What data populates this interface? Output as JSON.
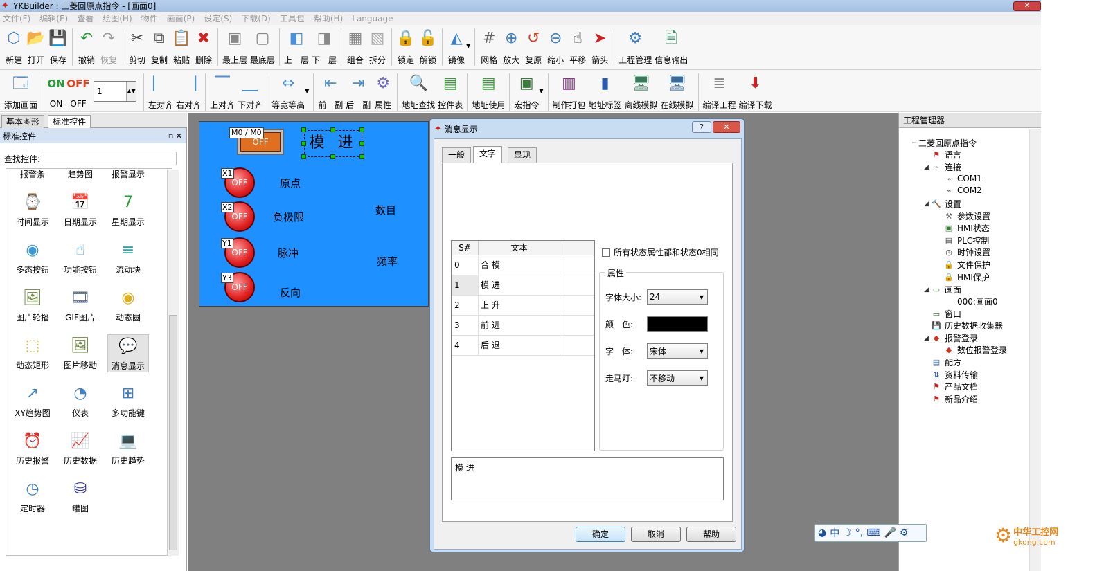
{
  "window": {
    "title": "YKBuilder : 三菱回原点指令 - [画面0]"
  },
  "menu": [
    "文件(F)",
    "编辑(E)",
    "查看",
    "绘图(H)",
    "物件",
    "画面(P)",
    "设定(S)",
    "下载(D)",
    "工具包",
    "帮助(H)",
    "Language"
  ],
  "toolbar1": [
    {
      "label": "新建",
      "icon": "new-icon",
      "glyph": "⬡",
      "color": "#3a7fc8"
    },
    {
      "label": "打开",
      "icon": "open-folder-icon",
      "glyph": "📂",
      "color": "#3a7fc8"
    },
    {
      "label": "保存",
      "icon": "save-icon",
      "glyph": "💾",
      "color": "#3a7fc8"
    },
    {
      "sep": true
    },
    {
      "label": "撤销",
      "icon": "undo-icon",
      "glyph": "↶",
      "color": "#2a9a3a"
    },
    {
      "label": "恢复",
      "icon": "redo-icon",
      "glyph": "↷",
      "color": "#9a9a9a",
      "disabled": true
    },
    {
      "sep": true
    },
    {
      "label": "剪切",
      "icon": "cut-icon",
      "glyph": "✂",
      "color": "#444"
    },
    {
      "label": "复制",
      "icon": "copy-icon",
      "glyph": "⧉",
      "color": "#666"
    },
    {
      "label": "粘贴",
      "icon": "paste-icon",
      "glyph": "📋",
      "color": "#2a9a3a"
    },
    {
      "label": "删除",
      "icon": "delete-icon",
      "glyph": "✖",
      "color": "#d02020"
    },
    {
      "sep": true
    },
    {
      "label": "最上层",
      "icon": "bring-to-front-icon",
      "glyph": "▣",
      "color": "#888"
    },
    {
      "label": "最底层",
      "icon": "send-to-back-icon",
      "glyph": "▢",
      "color": "#888"
    },
    {
      "sep": true
    },
    {
      "label": "上一层",
      "icon": "bring-forward-icon",
      "glyph": "◧",
      "color": "#4a90d8"
    },
    {
      "label": "下一层",
      "icon": "send-backward-icon",
      "glyph": "◨",
      "color": "#888"
    },
    {
      "sep": true
    },
    {
      "label": "组合",
      "icon": "group-icon",
      "glyph": "▦",
      "color": "#888"
    },
    {
      "label": "拆分",
      "icon": "ungroup-icon",
      "glyph": "▧",
      "color": "#aaa"
    },
    {
      "sep": true
    },
    {
      "label": "锁定",
      "icon": "lock-icon",
      "glyph": "🔒",
      "color": "#e0a020"
    },
    {
      "label": "解锁",
      "icon": "unlock-icon",
      "glyph": "🔓",
      "color": "#e0a020"
    },
    {
      "sep": true
    },
    {
      "label": "镜像",
      "icon": "mirror-icon",
      "glyph": "◭",
      "color": "#3a7fc8",
      "dropdown": true
    },
    {
      "sep": true
    },
    {
      "label": "网格",
      "icon": "grid-icon",
      "glyph": "#",
      "color": "#666"
    },
    {
      "label": "放大",
      "icon": "zoom-in-icon",
      "glyph": "⊕",
      "color": "#3a7fc8"
    },
    {
      "label": "复原",
      "icon": "restore-icon",
      "glyph": "↺",
      "color": "#d04020"
    },
    {
      "label": "缩小",
      "icon": "zoom-out-icon",
      "glyph": "⊖",
      "color": "#3a7fc8"
    },
    {
      "label": "平移",
      "icon": "pan-hand-icon",
      "glyph": "☝",
      "color": "#444"
    },
    {
      "label": "箭头",
      "icon": "arrow-pointer-icon",
      "glyph": "➤",
      "color": "#d02020"
    },
    {
      "sep": true
    },
    {
      "label": "工程管理",
      "icon": "project-manager-icon",
      "glyph": "⚙",
      "color": "#3a7fc8"
    },
    {
      "label": "信息输出",
      "icon": "info-output-icon",
      "glyph": "🗎",
      "color": "#3a9a6a"
    }
  ],
  "toolbar2": [
    {
      "label": "添加画面",
      "icon": "add-screen-icon",
      "glyph": "🗔",
      "color": "#3a7fc8"
    },
    {
      "sep": true
    },
    {
      "label": "ON",
      "icon": "on-icon",
      "glyph": "ON",
      "color": "#2a9a3a",
      "text": true
    },
    {
      "label": "OFF",
      "icon": "off-icon",
      "glyph": "OFF",
      "color": "#e04020",
      "text": true
    },
    {
      "spin": true
    },
    {
      "sep": true
    },
    {
      "label": "左对齐",
      "icon": "align-left-icon",
      "glyph": "⎸",
      "color": "#4a90d8"
    },
    {
      "label": "右对齐",
      "icon": "align-right-icon",
      "glyph": "⎹",
      "color": "#4a90d8"
    },
    {
      "sep": true
    },
    {
      "label": "上对齐",
      "icon": "align-top-icon",
      "glyph": "⎺",
      "color": "#4a90d8"
    },
    {
      "label": "下对齐",
      "icon": "align-bottom-icon",
      "glyph": "⎽",
      "color": "#4a90d8"
    },
    {
      "sep": true
    },
    {
      "label": "等宽等高",
      "icon": "same-size-icon",
      "glyph": "⇔",
      "color": "#4a90d8",
      "dropdown": true
    },
    {
      "sep": true
    },
    {
      "label": "前一副",
      "icon": "previous-screen-icon",
      "glyph": "⇤",
      "color": "#4a90d8"
    },
    {
      "label": "后一副",
      "icon": "next-screen-icon",
      "glyph": "⇥",
      "color": "#4a90d8"
    },
    {
      "label": "属性",
      "icon": "properties-icon",
      "glyph": "⚙",
      "color": "#6a6ac8"
    },
    {
      "sep": true
    },
    {
      "label": "地址查找",
      "icon": "address-search-icon",
      "glyph": "🔍",
      "color": "#2a8a6a"
    },
    {
      "label": "控件表",
      "icon": "control-table-icon",
      "glyph": "▤",
      "color": "#3a9a3a"
    },
    {
      "sep": true
    },
    {
      "label": "地址使用",
      "icon": "address-use-icon",
      "glyph": "▤",
      "color": "#3a9a3a"
    },
    {
      "sep": true
    },
    {
      "label": "宏指令",
      "icon": "macro-icon",
      "glyph": "▣",
      "color": "#3a7a3a",
      "dropdown": true
    },
    {
      "sep": true
    },
    {
      "label": "制作打包",
      "icon": "package-icon",
      "glyph": "▥",
      "color": "#8a3a8a"
    },
    {
      "label": "地址标签",
      "icon": "address-tag-icon",
      "glyph": "▮",
      "color": "#2a5ab0"
    },
    {
      "label": "离线模拟",
      "icon": "offline-sim-icon",
      "glyph": "🖥",
      "color": "#3a7a5a"
    },
    {
      "label": "在线模拟",
      "icon": "online-sim-icon",
      "glyph": "🖥",
      "color": "#3a6a9a"
    },
    {
      "sep": true
    },
    {
      "label": "编译工程",
      "icon": "compile-icon",
      "glyph": "≣",
      "color": "#888"
    },
    {
      "label": "编译下载",
      "icon": "compile-download-icon",
      "glyph": "⬇",
      "color": "#d02020"
    }
  ],
  "spin_value": "1",
  "left_tabs": [
    "基本图形",
    "标准控件"
  ],
  "left_panel": {
    "title": "标准控件",
    "search_label": "查找控件:",
    "search_value": "",
    "items": [
      {
        "label": "报警条",
        "icon": "alarm-bar-icon",
        "glyph": "",
        "color": "#444"
      },
      {
        "label": "趋势图",
        "icon": "trend-chart-icon",
        "glyph": "",
        "color": "#444"
      },
      {
        "label": "报警显示",
        "icon": "alarm-display-icon",
        "glyph": "",
        "color": "#444"
      },
      {
        "label": "时间显示",
        "icon": "time-display-icon",
        "glyph": "⌚",
        "color": "#3a7fc8"
      },
      {
        "label": "日期显示",
        "icon": "date-display-icon",
        "glyph": "📅",
        "color": "#e07020"
      },
      {
        "label": "星期显示",
        "icon": "week-display-icon",
        "glyph": "7",
        "color": "#2a9a3a"
      },
      {
        "label": "多态按钮",
        "icon": "multistate-button-icon",
        "glyph": "◉",
        "color": "#3a9ad8"
      },
      {
        "label": "功能按钮",
        "icon": "function-button-icon",
        "glyph": "☝",
        "color": "#3a9ad8"
      },
      {
        "label": "流动块",
        "icon": "flow-block-icon",
        "glyph": "≡",
        "color": "#2aa8a8"
      },
      {
        "label": "图片轮播",
        "icon": "picture-carousel-icon",
        "glyph": "🖼",
        "color": "#6a8a3a"
      },
      {
        "label": "GIF图片",
        "icon": "gif-picture-icon",
        "glyph": "🎞",
        "color": "#5a6a8a"
      },
      {
        "label": "动态圆",
        "icon": "dynamic-circle-icon",
        "glyph": "◉",
        "color": "#e0b020"
      },
      {
        "label": "动态矩形",
        "icon": "dynamic-rect-icon",
        "glyph": "⬚",
        "color": "#e0b020"
      },
      {
        "label": "图片移动",
        "icon": "picture-move-icon",
        "glyph": "🖼",
        "color": "#6a8a3a"
      },
      {
        "label": "消息显示",
        "icon": "message-display-icon",
        "glyph": "💬",
        "color": "#3a7fc8",
        "selected": true
      },
      {
        "label": "XY趋势图",
        "icon": "xy-trend-icon",
        "glyph": "↗",
        "color": "#3a7fc8"
      },
      {
        "label": "仪表",
        "icon": "meter-icon",
        "glyph": "◔",
        "color": "#3a7fc8"
      },
      {
        "label": "多功能键",
        "icon": "multifunction-key-icon",
        "glyph": "⊞",
        "color": "#3a7fc8"
      },
      {
        "label": "历史报警",
        "icon": "history-alarm-icon",
        "glyph": "⏰",
        "color": "#d02020"
      },
      {
        "label": "历史数据",
        "icon": "history-data-icon",
        "glyph": "📈",
        "color": "#d02020"
      },
      {
        "label": "历史趋势",
        "icon": "history-trend-icon",
        "glyph": "💻",
        "color": "#3a9a6a"
      },
      {
        "label": "定时器",
        "icon": "timer-icon",
        "glyph": "◷",
        "color": "#3a7fc8"
      },
      {
        "label": "罐图",
        "icon": "tank-icon",
        "glyph": "⛁",
        "color": "#2a2ab0"
      }
    ]
  },
  "hmi": {
    "switch": {
      "tag": "M0 / M0",
      "text": "OFF"
    },
    "message": "模 进",
    "lamps": [
      {
        "tag": "X1",
        "text": "OFF",
        "label": "原点"
      },
      {
        "tag": "X2",
        "text": "OFF",
        "label": "负极限"
      },
      {
        "tag": "Y1",
        "text": "OFF",
        "label": "脉冲"
      },
      {
        "tag": "Y3",
        "text": "OFF",
        "label": "反向"
      }
    ],
    "label_count": "数目",
    "label_freq": "频率"
  },
  "dialog": {
    "title": "消息显示",
    "help_btn": "?",
    "close_btn": "✕",
    "tabs": [
      "一般",
      "文字",
      "显现"
    ],
    "table_header": [
      "S#",
      "文本"
    ],
    "rows": [
      {
        "s": "0",
        "t": "合 模"
      },
      {
        "s": "1",
        "t": "模 进"
      },
      {
        "s": "2",
        "t": "上 升"
      },
      {
        "s": "3",
        "t": "前 进"
      },
      {
        "s": "4",
        "t": "后 退"
      }
    ],
    "same_state_label": "所有状态属性都和状态0相同",
    "props_title": "属性",
    "font_size_label": "字体大小:",
    "font_size_value": "24",
    "color_label": "颜　色:",
    "color_value": "#000000",
    "font_label": "字　体:",
    "font_value": "宋体",
    "marquee_label": "走马灯:",
    "marquee_value": "不移动",
    "text_value": "模 进",
    "ok": "确定",
    "cancel": "取消",
    "help": "帮助"
  },
  "right_panel": {
    "title": "工程管理器",
    "tree": [
      {
        "label": "三菱回原点指令",
        "level": 0,
        "toggle": "−",
        "icon": "project-icon",
        "glyph": ""
      },
      {
        "label": "语言",
        "level": 1,
        "toggle": "",
        "icon": "flag-icon",
        "glyph": "⚑",
        "color": "#d02020"
      },
      {
        "label": "连接",
        "level": 1,
        "toggle": "◢",
        "icon": "connect-icon",
        "glyph": "⌁",
        "color": "#666"
      },
      {
        "label": "COM1",
        "level": 2,
        "toggle": "",
        "icon": "com-port-icon",
        "glyph": "⌁",
        "color": "#666"
      },
      {
        "label": "COM2",
        "level": 2,
        "toggle": "",
        "icon": "com-port-icon",
        "glyph": "⌁",
        "color": "#666"
      },
      {
        "label": "设置",
        "level": 1,
        "toggle": "◢",
        "icon": "settings-hammer-icon",
        "glyph": "🔨",
        "color": "#666"
      },
      {
        "label": "参数设置",
        "level": 2,
        "toggle": "",
        "icon": "param-icon",
        "glyph": "⚒",
        "color": "#666"
      },
      {
        "label": "HMI状态",
        "level": 2,
        "toggle": "",
        "icon": "hmi-status-icon",
        "glyph": "▣",
        "color": "#3a7a3a"
      },
      {
        "label": "PLC控制",
        "level": 2,
        "toggle": "",
        "icon": "plc-control-icon",
        "glyph": "▤",
        "color": "#444"
      },
      {
        "label": "时钟设置",
        "level": 2,
        "toggle": "",
        "icon": "clock-icon",
        "glyph": "◷",
        "color": "#444"
      },
      {
        "label": "文件保护",
        "level": 2,
        "toggle": "",
        "icon": "file-lock-icon",
        "glyph": "🔒",
        "color": "#e0a020"
      },
      {
        "label": "HMI保护",
        "level": 2,
        "toggle": "",
        "icon": "hmi-lock-icon",
        "glyph": "🔒",
        "color": "#e0a020"
      },
      {
        "label": "画面",
        "level": 1,
        "toggle": "◢",
        "icon": "screen-icon",
        "glyph": "▭",
        "color": "#2a5a2a"
      },
      {
        "label": "000:画面0",
        "level": 2,
        "toggle": "",
        "icon": "",
        "glyph": "",
        "color": "#000"
      },
      {
        "label": "窗口",
        "level": 1,
        "toggle": "",
        "icon": "window-icon",
        "glyph": "▭",
        "color": "#2a5a2a"
      },
      {
        "label": "历史数据收集器",
        "level": 1,
        "toggle": "",
        "icon": "history-collector-icon",
        "glyph": "💾",
        "color": "#2a4ab0"
      },
      {
        "label": "报警登录",
        "level": 1,
        "toggle": "◢",
        "icon": "alarm-login-icon",
        "glyph": "◆",
        "color": "#d03020"
      },
      {
        "label": "数位报警登录",
        "level": 2,
        "toggle": "",
        "icon": "bit-alarm-icon",
        "glyph": "◆",
        "color": "#d03020"
      },
      {
        "label": "配方",
        "level": 1,
        "toggle": "",
        "icon": "recipe-icon",
        "glyph": "▤",
        "color": "#3a6a9a"
      },
      {
        "label": "资料传输",
        "level": 1,
        "toggle": "",
        "icon": "data-transfer-icon",
        "glyph": "⇅",
        "color": "#2a5ab0"
      },
      {
        "label": "产品文档",
        "level": 1,
        "toggle": "",
        "icon": "flag-icon",
        "glyph": "⚑",
        "color": "#d02020"
      },
      {
        "label": "新品介绍",
        "level": 1,
        "toggle": "",
        "icon": "flag-icon",
        "glyph": "⚑",
        "color": "#d02020"
      }
    ]
  },
  "ime": [
    "中",
    "☽",
    "°,",
    "⌨",
    "🎤",
    "⚙"
  ],
  "watermark": {
    "line1": "中华工控网",
    "line2": "gkong.com"
  }
}
